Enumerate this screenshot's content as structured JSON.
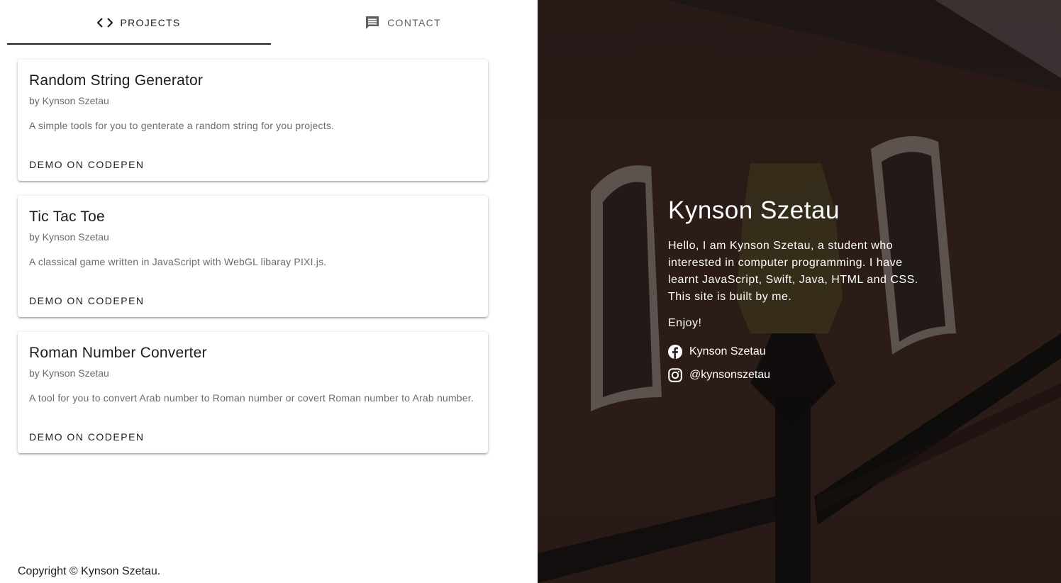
{
  "tabs": [
    {
      "label": "PROJECTS",
      "icon": "code-icon",
      "active": true
    },
    {
      "label": "CONTACT",
      "icon": "message-icon",
      "active": false
    }
  ],
  "projects": [
    {
      "title": "Random String Generator",
      "author": "by Kynson Szetau",
      "description": "A simple tools for you to genterate a random string for you projects.",
      "action": "DEMO ON CODEPEN"
    },
    {
      "title": "Tic Tac Toe",
      "author": "by Kynson Szetau",
      "description": "A classical game written in JavaScript with WebGL libaray PIXI.js.",
      "action": "DEMO ON CODEPEN"
    },
    {
      "title": "Roman Number Converter",
      "author": "by Kynson Szetau",
      "description": "A tool for you to convert Arab number to Roman number or covert Roman number to Arab number.",
      "action": "DEMO ON CODEPEN"
    }
  ],
  "footer": {
    "copyright": "Copyright © Kynson Szetau."
  },
  "profile": {
    "name": "Kynson Szetau",
    "bio": "Hello, I am Kynson Szetau, a student who interested in computer programming. I have learnt JavaScript, Swift, Java, HTML and CSS. This site is built by me.",
    "enjoy": "Enjoy!",
    "social": [
      {
        "icon": "facebook-icon",
        "label": "Kynson Szetau"
      },
      {
        "icon": "instagram-icon",
        "label": "@kynsonszetau"
      }
    ]
  },
  "colors": {
    "text_dark": "#1d1d1d",
    "text_muted": "#6b6b6b",
    "hero_text": "#ffffff"
  }
}
